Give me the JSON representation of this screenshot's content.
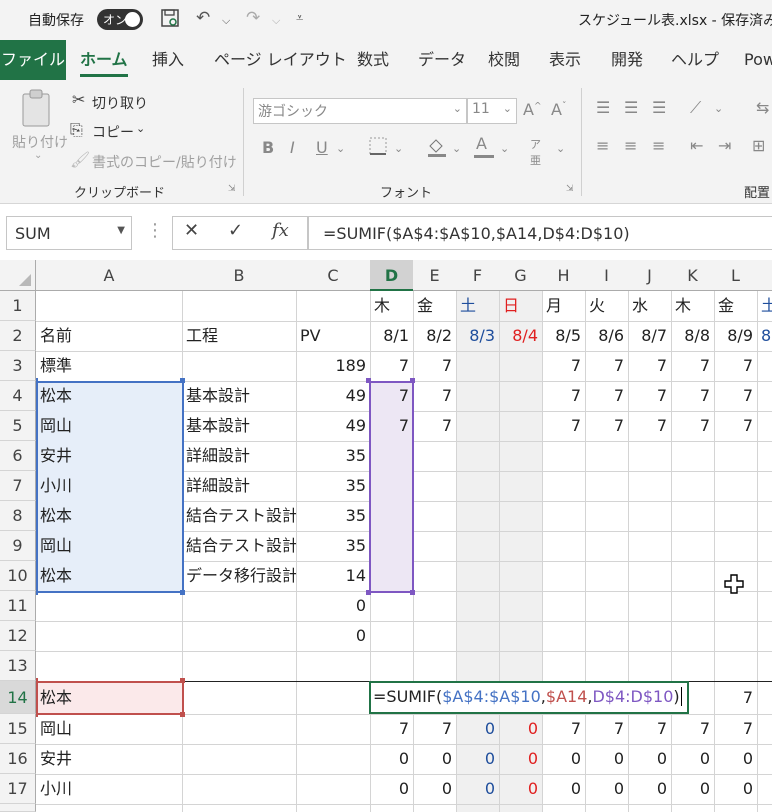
{
  "title_bar": {
    "autosave_label": "自動保存",
    "autosave_state": "オン",
    "file_title": "スケジュール表.xlsx  -  保存済み"
  },
  "tabs": [
    "ファイル",
    "ホーム",
    "挿入",
    "ページ レイアウト",
    "数式",
    "データ",
    "校閲",
    "表示",
    "開発",
    "ヘルプ",
    "Pow"
  ],
  "active_tab": "ホーム",
  "ribbon": {
    "paste": "貼り付け",
    "cut": "切り取り",
    "copy": "コピー",
    "format_painter": "書式のコピー/貼り付け",
    "clipboard_group": "クリップボード",
    "font_name": "游ゴシック",
    "font_size": "11",
    "font_group": "フォント",
    "alignment_group": "配置"
  },
  "formula_bar": {
    "name_box": "SUM",
    "fx": "fx",
    "formula": "=SUMIF($A$4:$A$10,$A14,D$4:D$10)"
  },
  "columns": {
    "headers": [
      "A",
      "B",
      "C",
      "D",
      "E",
      "F",
      "G",
      "H",
      "I",
      "J",
      "K",
      "L"
    ],
    "selected": "D"
  },
  "rows": {
    "headers": [
      "1",
      "2",
      "3",
      "4",
      "5",
      "6",
      "7",
      "8",
      "9",
      "10",
      "11",
      "12",
      "13",
      "14",
      "15",
      "16",
      "17"
    ],
    "selected": "14"
  },
  "sheet": {
    "weekdays": [
      "木",
      "金",
      "土",
      "日",
      "月",
      "火",
      "水",
      "木",
      "金",
      "土"
    ],
    "dates": [
      "8/1",
      "8/2",
      "8/3",
      "8/4",
      "8/5",
      "8/6",
      "8/7",
      "8/8",
      "8/9",
      "8"
    ],
    "header_row": {
      "name": "名前",
      "process": "工程",
      "pv": "PV"
    },
    "data_rows": [
      {
        "name": "標準",
        "process": "",
        "pv": "189",
        "days": [
          "7",
          "7",
          "",
          "",
          "7",
          "7",
          "7",
          "7",
          "7"
        ]
      },
      {
        "name": "松本",
        "process": "基本設計",
        "pv": "49",
        "days": [
          "7",
          "7",
          "",
          "",
          "7",
          "7",
          "7",
          "7",
          "7"
        ]
      },
      {
        "name": "岡山",
        "process": "基本設計",
        "pv": "49",
        "days": [
          "7",
          "7",
          "",
          "",
          "7",
          "7",
          "7",
          "7",
          "7"
        ]
      },
      {
        "name": "安井",
        "process": "詳細設計",
        "pv": "35",
        "days": []
      },
      {
        "name": "小川",
        "process": "詳細設計",
        "pv": "35",
        "days": []
      },
      {
        "name": "松本",
        "process": "結合テスト設計",
        "pv": "35",
        "days": []
      },
      {
        "name": "岡山",
        "process": "結合テスト設計",
        "pv": "35",
        "days": []
      },
      {
        "name": "松本",
        "process": "データ移行設計",
        "pv": "14",
        "days": []
      },
      {
        "name": "",
        "process": "",
        "pv": "0",
        "days": []
      },
      {
        "name": "",
        "process": "",
        "pv": "0",
        "days": []
      },
      {
        "name": "",
        "process": "",
        "pv": "",
        "days": []
      }
    ],
    "summary_rows": [
      {
        "name": "松本",
        "days": [
          "",
          "",
          "",
          "",
          "",
          "",
          "",
          "",
          "7"
        ]
      },
      {
        "name": "岡山",
        "days": [
          "7",
          "7",
          "0",
          "0",
          "7",
          "7",
          "7",
          "7",
          "7"
        ]
      },
      {
        "name": "安井",
        "days": [
          "0",
          "0",
          "0",
          "0",
          "0",
          "0",
          "0",
          "0",
          "0"
        ]
      },
      {
        "name": "小川",
        "days": [
          "0",
          "0",
          "0",
          "0",
          "0",
          "0",
          "0",
          "0",
          "0"
        ]
      }
    ],
    "editing_formula": {
      "prefix": "=SUMIF(",
      "arg1": "$A$4:$A$10",
      "comma1": ",",
      "arg2": "$A14",
      "comma2": ",",
      "arg3": "D$4:D$10",
      "suffix": ")"
    }
  },
  "colors": {
    "excel_green": "#217346",
    "saturday_blue": "#1f4e9c",
    "sunday_red": "#e02020",
    "range_blue": "#4472c4",
    "range_red": "#c0504d",
    "range_purple": "#7e57c2"
  }
}
